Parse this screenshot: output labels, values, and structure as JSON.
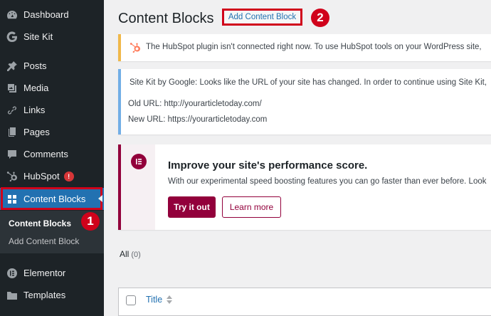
{
  "sidebar": {
    "items": [
      {
        "label": "Dashboard",
        "icon": "dashboard-icon"
      },
      {
        "label": "Site Kit",
        "icon": "google-g-icon"
      },
      {
        "label": "Posts",
        "icon": "pin-icon"
      },
      {
        "label": "Media",
        "icon": "media-icon"
      },
      {
        "label": "Links",
        "icon": "link-icon"
      },
      {
        "label": "Pages",
        "icon": "pages-icon"
      },
      {
        "label": "Comments",
        "icon": "comment-icon"
      },
      {
        "label": "HubSpot",
        "icon": "hubspot-icon",
        "badge": "!"
      },
      {
        "label": "Content Blocks",
        "icon": "grid-icon",
        "active": true
      },
      {
        "label": "Elementor",
        "icon": "elementor-icon"
      },
      {
        "label": "Templates",
        "icon": "folder-icon"
      }
    ],
    "submenu": [
      {
        "label": "Content Blocks",
        "current": true
      },
      {
        "label": "Add Content Block"
      }
    ]
  },
  "callouts": [
    "1",
    "2"
  ],
  "header": {
    "title": "Content Blocks",
    "add_button": "Add Content Block"
  },
  "notices": {
    "hubspot": "The HubSpot plugin isn't connected right now. To use HubSpot tools on your WordPress site,",
    "sitekit": {
      "message": "Site Kit by Google: Looks like the URL of your site has changed. In order to continue using Site Kit,",
      "old_url": "Old URL: http://yourarticletoday.com/",
      "new_url": "New URL: https://yourarticletoday.com"
    },
    "elementor": {
      "title": "Improve your site's performance score.",
      "text": "With our experimental speed boosting features you can go faster than ever before. Look",
      "try_button": "Try it out",
      "learn_button": "Learn more"
    }
  },
  "filters": {
    "all_label": "All",
    "all_count": "(0)"
  },
  "table": {
    "columns": [
      "Title"
    ]
  },
  "colors": {
    "sidebar_bg": "#1d2327",
    "active_bg": "#2271b1",
    "elementor_accent": "#92003b",
    "callout_red": "#d0021b"
  }
}
